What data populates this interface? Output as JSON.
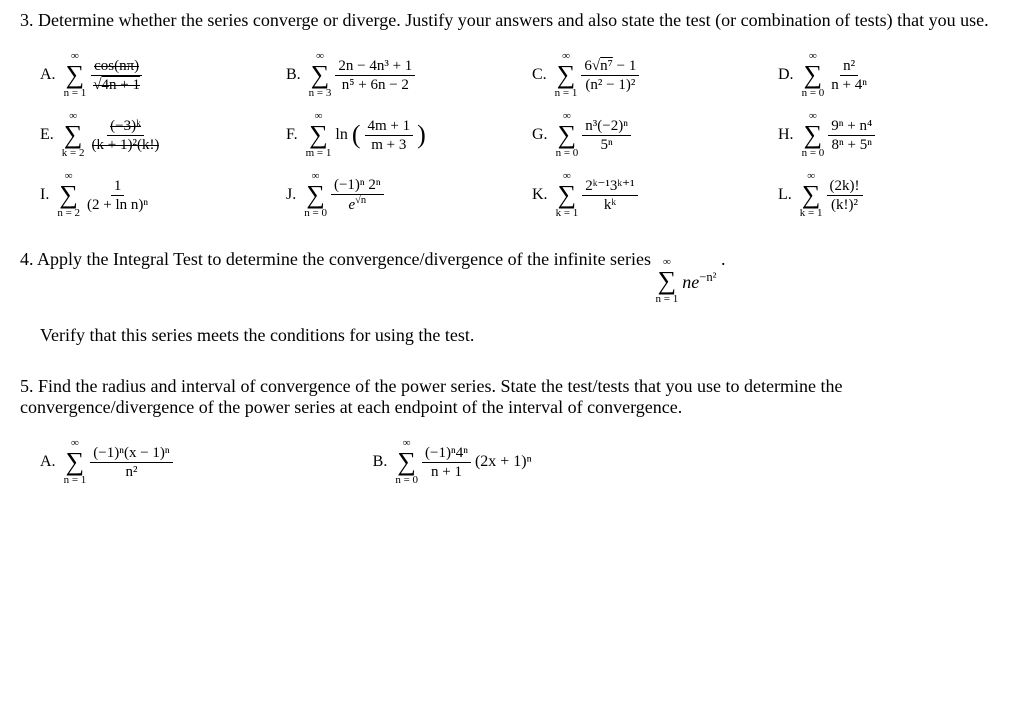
{
  "q3": {
    "number": "3.",
    "text": "Determine whether the series converge or diverge. Justify your answers and also state the test (or combination of tests) that you use.",
    "items": {
      "A": {
        "label": "A.",
        "lower": "n = 1",
        "upper": "∞",
        "num": "cos(nπ)",
        "den_sqrt": "4n + 1"
      },
      "B": {
        "label": "B.",
        "lower": "n = 3",
        "upper": "∞",
        "num": "2n − 4n³ + 1",
        "den": "n⁵ + 6n − 2"
      },
      "C": {
        "label": "C.",
        "lower": "n = 1",
        "upper": "∞",
        "num_a": "6",
        "num_sqrt": "n⁷",
        "num_b": " − 1",
        "den": "(n² − 1)²"
      },
      "D": {
        "label": "D.",
        "lower": "n = 0",
        "upper": "∞",
        "num": "n²",
        "den": "n + 4ⁿ"
      },
      "E": {
        "label": "E.",
        "lower": "k = 2",
        "upper": "∞",
        "num": "(−3)ᵏ",
        "den": "(k + 1)²(k!)"
      },
      "F": {
        "label": "F.",
        "lower": "m = 1",
        "upper": "∞",
        "ln": "ln",
        "num": "4m + 1",
        "den": "m + 3"
      },
      "G": {
        "label": "G.",
        "lower": "n = 0",
        "upper": "∞",
        "num": "n³(−2)ⁿ",
        "den": "5ⁿ"
      },
      "H": {
        "label": "H.",
        "lower": "n = 0",
        "upper": "∞",
        "num": "9ⁿ + n⁴",
        "den": "8ⁿ + 5ⁿ"
      },
      "I": {
        "label": "I.",
        "lower": "n = 2",
        "upper": "∞",
        "num": "1",
        "den": "(2 + ln n)ⁿ"
      },
      "J": {
        "label": "J.",
        "lower": "n = 0",
        "upper": "∞",
        "num": "(−1)ⁿ 2ⁿ",
        "den_e": "e",
        "den_sqrt": "n"
      },
      "K": {
        "label": "K.",
        "lower": "k = 1",
        "upper": "∞",
        "num": "2ᵏ⁻¹3ᵏ⁺¹",
        "den": "kᵏ"
      },
      "L": {
        "label": "L.",
        "lower": "k = 1",
        "upper": "∞",
        "num": "(2k)!",
        "den": "(k!)²"
      }
    }
  },
  "q4": {
    "number": "4.",
    "text_a": "Apply the Integral Test to determine the convergence/divergence of the infinite series ",
    "sum_lower": "n = 1",
    "sum_upper": "∞",
    "expr": "ne",
    "exp": "−n²",
    "text_b": "Verify that this series meets the conditions for using the test."
  },
  "q5": {
    "number": "5.",
    "text": "Find the radius and interval of convergence of the power series. State the test/tests that you use to determine the convergence/divergence of the power series at each endpoint of the interval of convergence.",
    "A": {
      "label": "A.",
      "lower": "n = 1",
      "upper": "∞",
      "num": "(−1)ⁿ(x − 1)ⁿ",
      "den": "n²"
    },
    "B": {
      "label": "B.",
      "lower": "n = 0",
      "upper": "∞",
      "num": "(−1)ⁿ4ⁿ",
      "den": "n + 1",
      "tail": "(2x + 1)ⁿ"
    }
  }
}
